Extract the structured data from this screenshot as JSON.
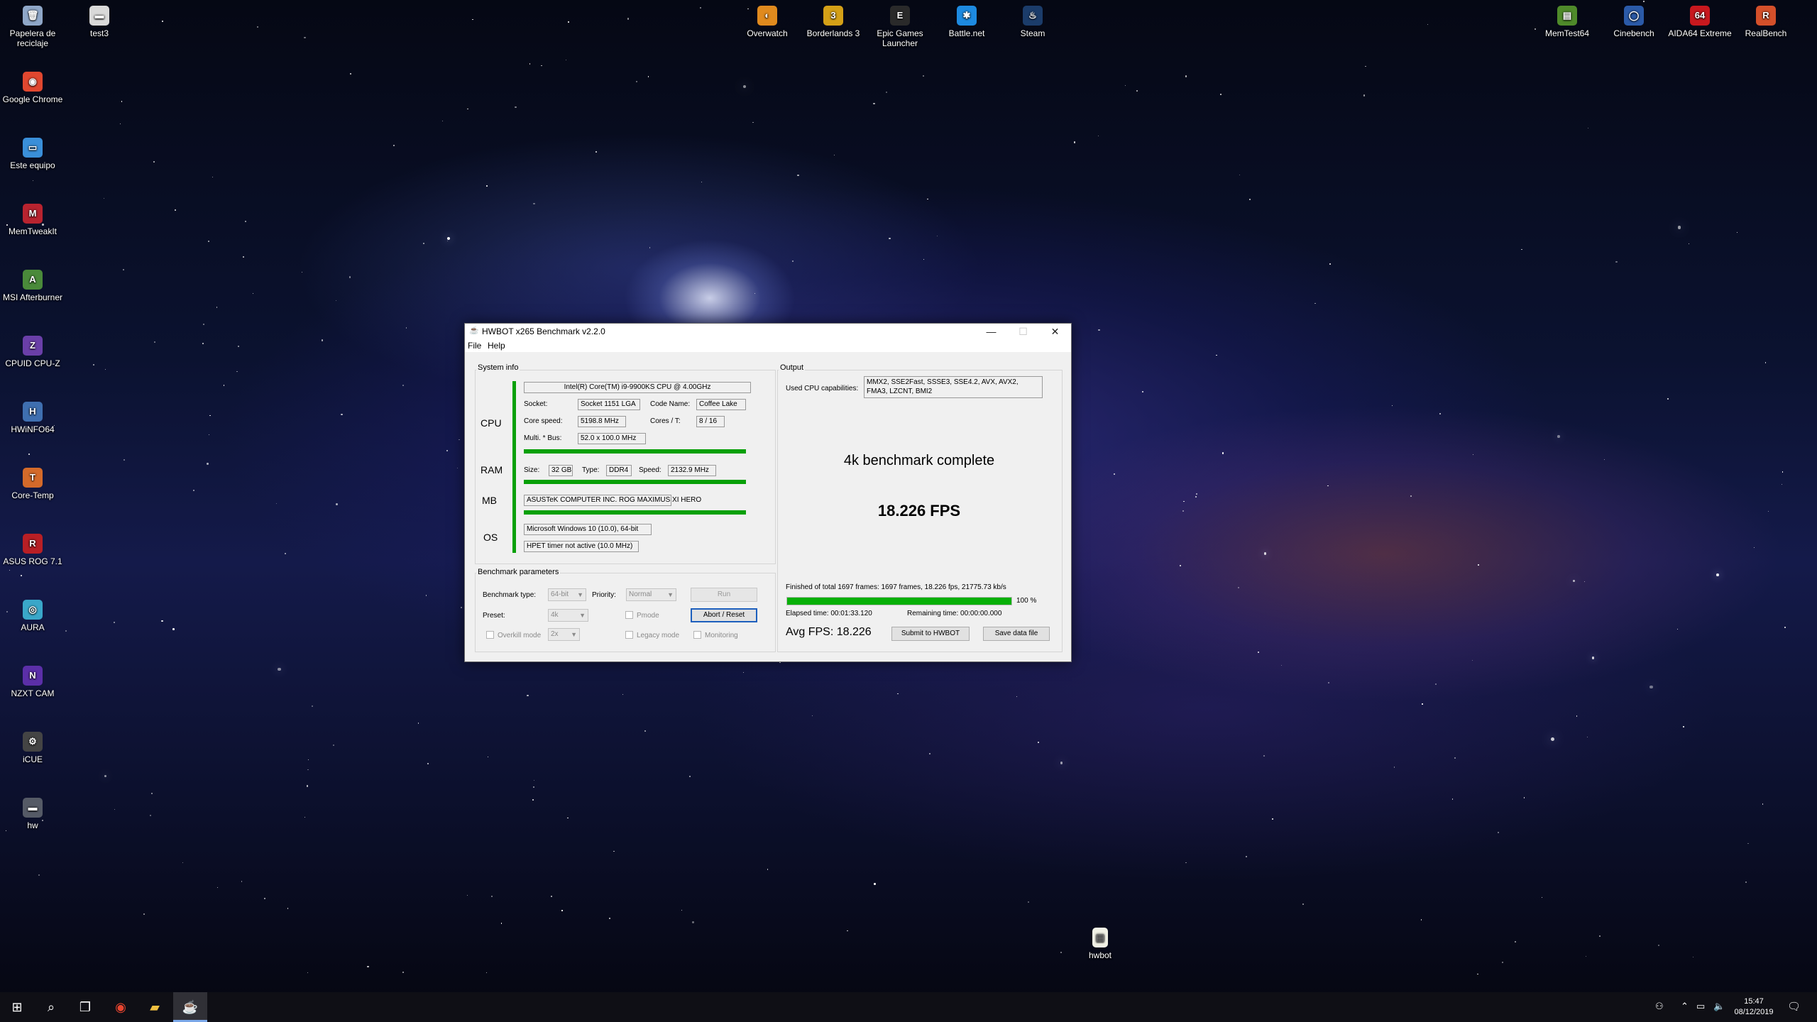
{
  "desktop": {
    "left_icons": [
      {
        "label": "Papelera de reciclaje",
        "icon": "recycle-bin-icon",
        "color": "#8fa7c8",
        "glyph": "🗑"
      },
      {
        "label": "Google Chrome",
        "icon": "chrome-icon",
        "color": "#e0472f",
        "glyph": "◉"
      },
      {
        "label": "Este equipo",
        "icon": "computer-icon",
        "color": "#3a8fd9",
        "glyph": "▭"
      },
      {
        "label": "MemTweakIt",
        "icon": "memtweakit-icon",
        "color": "#b8232f",
        "glyph": "M"
      },
      {
        "label": "MSI Afterburner",
        "icon": "afterburner-icon",
        "color": "#4a8a3a",
        "glyph": "A"
      },
      {
        "label": "CPUID CPU-Z",
        "icon": "cpuz-icon",
        "color": "#6a3fa8",
        "glyph": "Z"
      },
      {
        "label": "HWiNFO64",
        "icon": "hwinfo-icon",
        "color": "#3f6fb0",
        "glyph": "H"
      },
      {
        "label": "Core-Temp",
        "icon": "coretemp-icon",
        "color": "#d46a2a",
        "glyph": "T"
      },
      {
        "label": "ASUS ROG 7.1",
        "icon": "rog-icon",
        "color": "#b81f25",
        "glyph": "R"
      },
      {
        "label": "AURA",
        "icon": "aura-icon",
        "color": "#3aa7c9",
        "glyph": "◎"
      },
      {
        "label": "NZXT CAM",
        "icon": "nzxt-icon",
        "color": "#5b2fa8",
        "glyph": "N"
      },
      {
        "label": "iCUE",
        "icon": "icue-icon",
        "color": "#444444",
        "glyph": "⚙"
      },
      {
        "label": "hw",
        "icon": "file-icon",
        "color": "#555a66",
        "glyph": "▬"
      }
    ],
    "top_icons": [
      {
        "label": "test3",
        "icon": "file-icon",
        "color": "#d9d9d9",
        "glyph": "▬"
      },
      {
        "label": "Overwatch",
        "icon": "overwatch-icon",
        "color": "#e08a1e",
        "glyph": "◐"
      },
      {
        "label": "Borderlands 3",
        "icon": "borderlands-icon",
        "color": "#d4a017",
        "glyph": "3"
      },
      {
        "label": "Epic Games Launcher",
        "icon": "epic-icon",
        "color": "#2a2a2a",
        "glyph": "E"
      },
      {
        "label": "Battle.net",
        "icon": "battlenet-icon",
        "color": "#1d8ae0",
        "glyph": "✱"
      },
      {
        "label": "Steam",
        "icon": "steam-icon",
        "color": "#1b3c6a",
        "glyph": "♨"
      },
      {
        "label": "MemTest64",
        "icon": "memtest-icon",
        "color": "#4f8a2a",
        "glyph": "▤"
      },
      {
        "label": "Cinebench",
        "icon": "cinebench-icon",
        "color": "#2b5aa8",
        "glyph": "◯"
      },
      {
        "label": "AIDA64 Extreme",
        "icon": "aida64-icon",
        "color": "#c8181e",
        "glyph": "64"
      },
      {
        "label": "RealBench",
        "icon": "realbench-icon",
        "color": "#d4502a",
        "glyph": "R"
      }
    ],
    "bottom_icon": {
      "label": "hwbot",
      "icon": "document-icon",
      "color": "#f2f2e6",
      "glyph": "▤"
    }
  },
  "window": {
    "title": "HWBOT x265 Benchmark v2.2.0",
    "menu": [
      "File",
      "Help"
    ],
    "system_info": {
      "group_label": "System info",
      "cpu_heading": "CPU",
      "cpu_name": "Intel(R) Core(TM) i9-9900KS CPU @ 4.00GHz",
      "socket_label": "Socket:",
      "socket": "Socket 1151 LGA",
      "codename_label": "Code Name:",
      "codename": "Coffee Lake",
      "corespeed_label": "Core speed:",
      "corespeed": "5198.8 MHz",
      "cores_label": "Cores / T:",
      "cores": "8 / 16",
      "multi_label": "Multi. * Bus:",
      "multi": "52.0 x 100.0 MHz",
      "ram_heading": "RAM",
      "size_label": "Size:",
      "size": "32 GB",
      "type_label": "Type:",
      "type": "DDR4",
      "speed_label": "Speed:",
      "speed": "2132.9 MHz",
      "mb_heading": "MB",
      "mb": "ASUSTeK COMPUTER INC. ROG MAXIMUS XI HERO",
      "os_heading": "OS",
      "os": "Microsoft Windows 10 (10.0), 64-bit",
      "timer": "HPET timer not active (10.0 MHz)"
    },
    "params": {
      "group_label": "Benchmark parameters",
      "type_label": "Benchmark type:",
      "type_value": "64-bit",
      "priority_label": "Priority:",
      "priority_value": "Normal",
      "run_label": "Run",
      "preset_label": "Preset:",
      "preset_value": "4k",
      "pmode_label": "Pmode",
      "abort_label": "Abort / Reset",
      "overkill_label": "Overkill mode",
      "overkill_value": "2x",
      "legacy_label": "Legacy mode",
      "monitoring_label": "Monitoring"
    },
    "output": {
      "group_label": "Output",
      "caps_label": "Used CPU capabilities:",
      "caps": [
        "MMX2, SSE2Fast, SSSE3, SSE4.2, AVX, AVX2,",
        "FMA3, LZCNT, BMI2"
      ],
      "complete_text": "4k benchmark complete",
      "fps_text": "18.226 FPS",
      "finished_text": "Finished of total 1697 frames: 1697 frames, 18.226 fps,  21775.73 kb/s",
      "progress_fraction": 1.0,
      "progress_text": "100 %",
      "elapsed_text": "Elapsed time: 00:01:33.120",
      "remaining_text": "Remaining time: 00:00:00.000",
      "avg_fps_text": "Avg FPS: 18.226",
      "submit_label": "Submit to HWBOT",
      "save_label": "Save data file"
    }
  },
  "taskbar": {
    "time": "15:47",
    "date": "08/12/2019"
  },
  "colors": {
    "bar_green": "#07a007",
    "focus_blue": "#1d5fbd"
  }
}
